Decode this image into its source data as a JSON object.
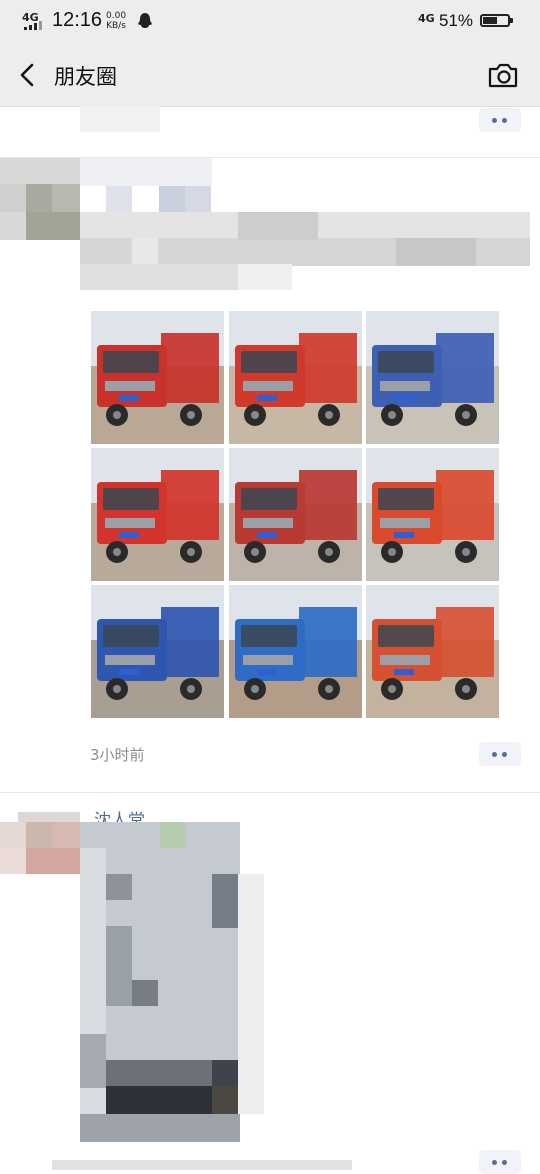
{
  "status_bar": {
    "network_left": "4G",
    "time": "12:16",
    "speed_value": "0.00",
    "speed_unit": "KB/s",
    "network_right": "4G",
    "battery_percent": "51%"
  },
  "nav": {
    "title": "朋友圈",
    "back_icon": "back-chevron-icon",
    "camera_icon": "camera-icon"
  },
  "post": {
    "timestamp": "3小时前",
    "photos": [
      {
        "icon": "truck-photo",
        "truck_color": "#c8322a",
        "bg": "#b9a896"
      },
      {
        "icon": "truck-photo",
        "truck_color": "#cf3a2c",
        "bg": "#c7b8a6"
      },
      {
        "icon": "truck-photo",
        "truck_color": "#3d5fb4",
        "bg": "#c8c2b8"
      },
      {
        "icon": "truck-photo",
        "truck_color": "#d2342d",
        "bg": "#b8aa9a"
      },
      {
        "icon": "truck-photo",
        "truck_color": "#b83a33",
        "bg": "#bdb3a8"
      },
      {
        "icon": "truck-photo",
        "truck_color": "#d94a2e",
        "bg": "#c6c2bc"
      },
      {
        "icon": "truck-photo",
        "truck_color": "#2f56b0",
        "bg": "#a89e92"
      },
      {
        "icon": "truck-photo",
        "truck_color": "#2e6cc6",
        "bg": "#b39c88"
      },
      {
        "icon": "truck-photo",
        "truck_color": "#d55132",
        "bg": "#c2b29e"
      }
    ]
  },
  "next_post": {
    "name_fragment": "沈人堂"
  },
  "colors": {
    "bar_bg": "#ededed",
    "link_blue": "#576b95",
    "time_gray": "#8c8c8c"
  }
}
